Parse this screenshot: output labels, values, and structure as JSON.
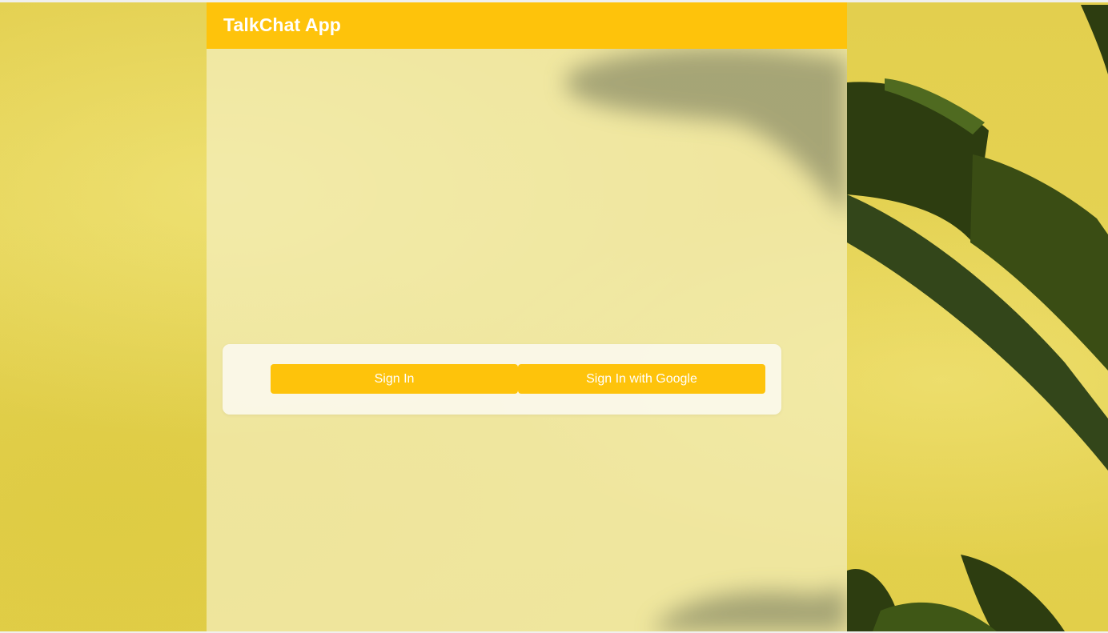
{
  "header": {
    "title": "TalkChat App"
  },
  "auth": {
    "sign_in_label": "Sign In",
    "google_sign_in_label": "Sign In with Google"
  },
  "colors": {
    "accent": "#fec30b",
    "background": "#e3cf4e",
    "leaf": "#2b3a10"
  },
  "background": {
    "image": "yellow-wall-with-banana-leaves"
  }
}
